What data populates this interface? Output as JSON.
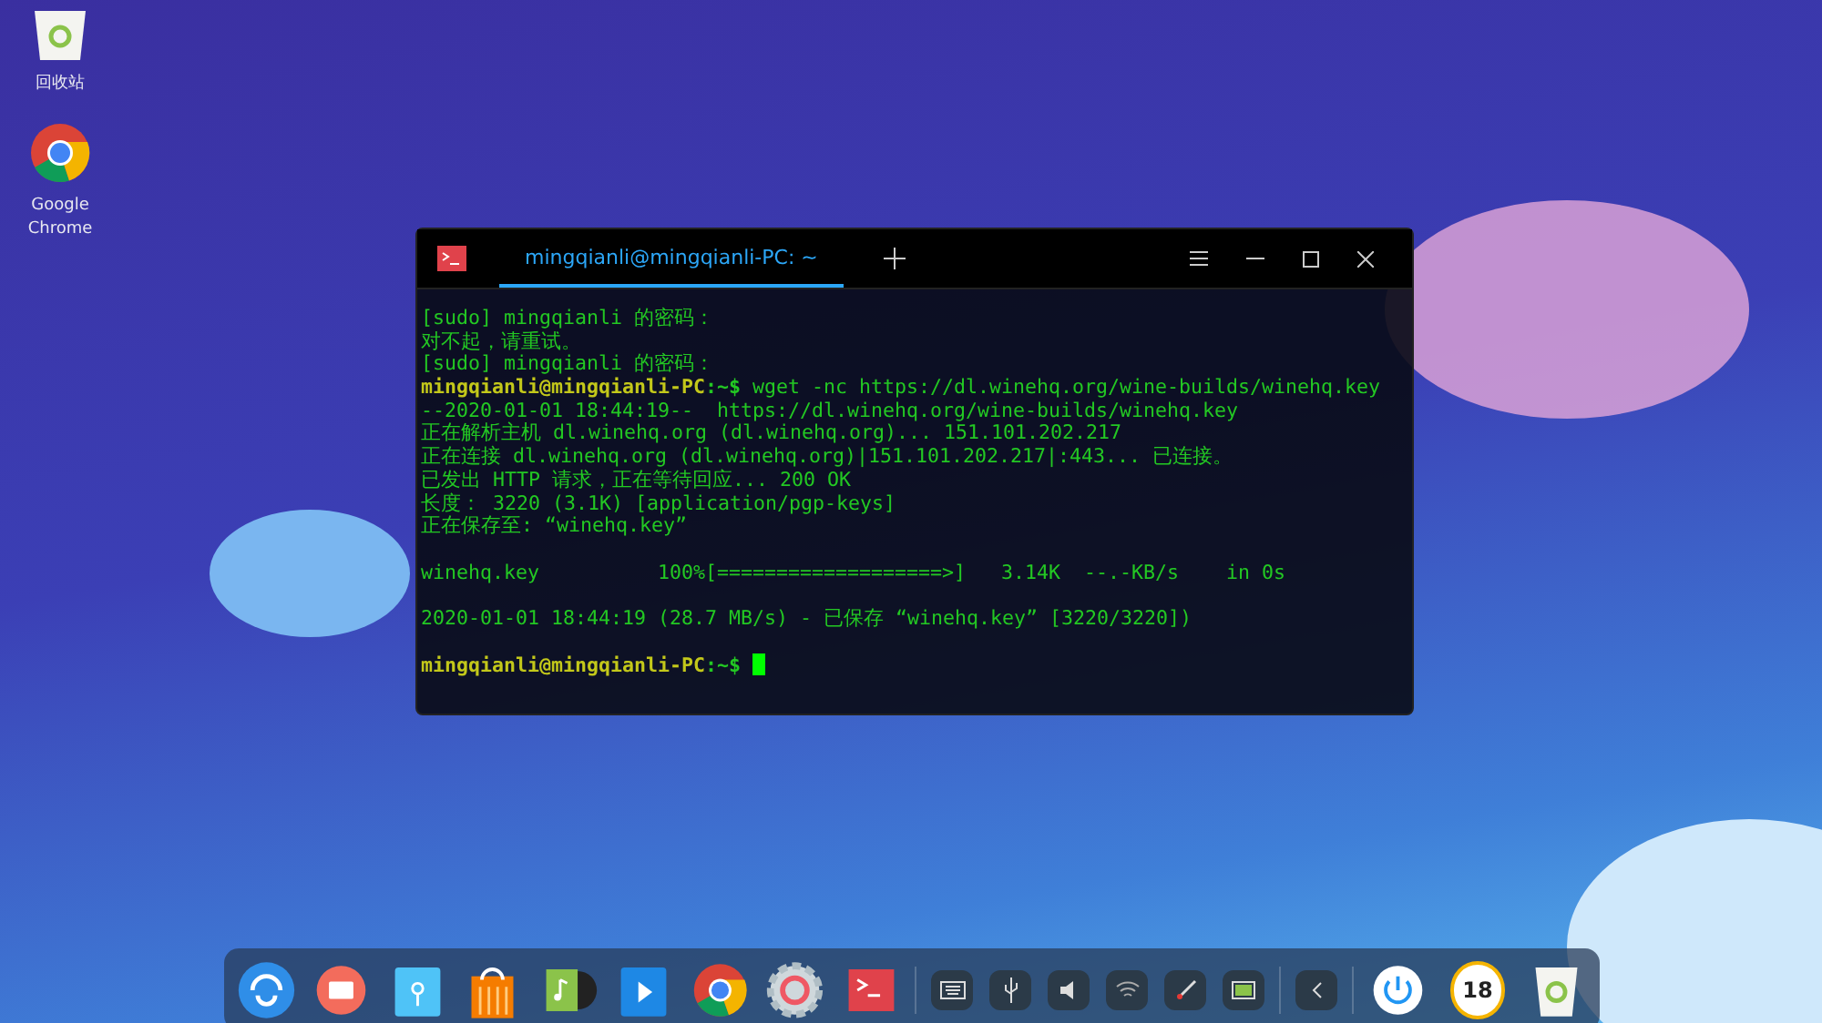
{
  "desktop_icons": [
    {
      "kind": "trash",
      "label": "回收站"
    },
    {
      "kind": "chrome",
      "label": "Google Chrome"
    }
  ],
  "terminal": {
    "tab": {
      "title": "mingqianli@mingqianli-PC: ~",
      "selected": true
    },
    "lines": [
      {
        "kind": "output",
        "text": "[sudo] mingqianli 的密码："
      },
      {
        "kind": "output",
        "text": "对不起，请重试。"
      },
      {
        "kind": "output",
        "text": "[sudo] mingqianli 的密码："
      },
      {
        "kind": "prompt",
        "user": "mingqianli@mingqianli-PC",
        "path": ":~$",
        "command": "wget -nc https://dl.winehq.org/wine-builds/winehq.key",
        "cursor": false
      },
      {
        "kind": "output",
        "text": "--2020-01-01 18:44:19--  https://dl.winehq.org/wine-builds/winehq.key"
      },
      {
        "kind": "output",
        "text": "正在解析主机 dl.winehq.org (dl.winehq.org)... 151.101.202.217"
      },
      {
        "kind": "output",
        "text": "正在连接 dl.winehq.org (dl.winehq.org)|151.101.202.217|:443... 已连接。"
      },
      {
        "kind": "output",
        "text": "已发出 HTTP 请求，正在等待回应... 200 OK"
      },
      {
        "kind": "output",
        "text": "长度： 3220 (3.1K) [application/pgp-keys]"
      },
      {
        "kind": "output",
        "text": "正在保存至: “winehq.key”"
      },
      {
        "kind": "blank"
      },
      {
        "kind": "output",
        "text": "winehq.key          100%[===================>]   3.14K  --.-KB/s    in 0s"
      },
      {
        "kind": "blank"
      },
      {
        "kind": "output",
        "text": "2020-01-01 18:44:19 (28.7 MB/s) - 已保存 “winehq.key” [3220/3220])"
      },
      {
        "kind": "blank"
      },
      {
        "kind": "prompt",
        "user": "mingqianli@mingqianli-PC",
        "path": ":~$",
        "cursor": true
      }
    ]
  },
  "dock": {
    "apps": [
      {
        "kind": "launcher"
      },
      {
        "kind": "multitask"
      },
      {
        "kind": "files"
      },
      {
        "kind": "store"
      },
      {
        "kind": "music"
      },
      {
        "kind": "video"
      },
      {
        "kind": "chrome"
      },
      {
        "kind": "settings"
      },
      {
        "kind": "terminal"
      }
    ],
    "tray": [
      {
        "kind": "keyboard"
      },
      {
        "kind": "usb"
      },
      {
        "kind": "volume"
      },
      {
        "kind": "wifi"
      },
      {
        "kind": "pen"
      },
      {
        "kind": "battery"
      }
    ],
    "clock_text": "18"
  }
}
